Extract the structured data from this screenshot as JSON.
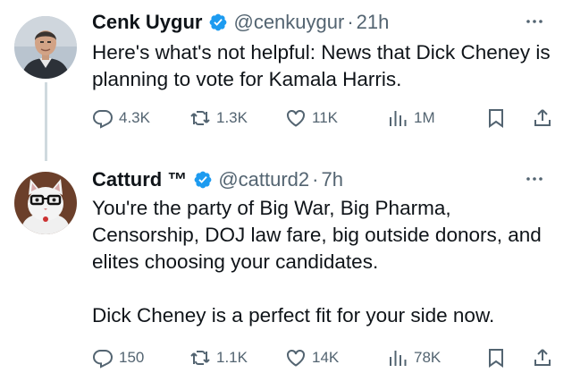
{
  "tweets": [
    {
      "name": "Cenk Uygur",
      "handle": "@cenkuygur",
      "separator": "·",
      "time": "21h",
      "text": "Here's what's not helpful: News that Dick Cheney is planning to vote for Kamala Harris.",
      "replies": "4.3K",
      "retweets": "1.3K",
      "likes": "11K",
      "views": "1M"
    },
    {
      "name": "Catturd ™",
      "handle": "@catturd2",
      "separator": "·",
      "time": "7h",
      "text": "You're the party of Big War, Big Pharma, Censorship, DOJ law fare, big outside donors, and elites choosing your candidates.\n\nDick Cheney is a perfect fit for your side now.",
      "replies": "150",
      "retweets": "1.1K",
      "likes": "14K",
      "views": "78K"
    }
  ],
  "colors": {
    "text": "#0f1419",
    "secondary": "#536471",
    "verified": "#1d9bf0",
    "thread": "#cfd9de"
  },
  "icons": [
    "verified-badge-icon",
    "more-icon",
    "reply-icon",
    "retweet-icon",
    "like-icon",
    "views-icon",
    "bookmark-icon",
    "share-icon"
  ]
}
